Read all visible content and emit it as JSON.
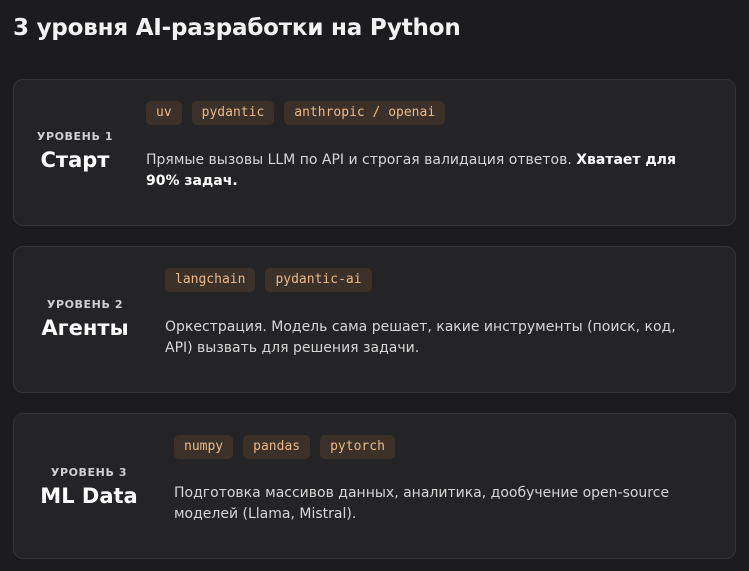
{
  "title": "3 уровня AI-разработки на Python",
  "levels": [
    {
      "label": "УРОВЕНЬ 1",
      "name": "Старт",
      "tags": [
        "uv",
        "pydantic",
        "anthropic / openai"
      ],
      "description": "Прямые вызовы LLM по API и строгая валидация ответов. ",
      "description_bold": "Хватает для 90% задач."
    },
    {
      "label": "УРОВЕНЬ 2",
      "name": "Агенты",
      "tags": [
        "langchain",
        "pydantic-ai"
      ],
      "description": "Оркестрация. Модель сама решает, какие инструменты (поиск, код, API) вызвать для решения задачи.",
      "description_bold": ""
    },
    {
      "label": "УРОВЕНЬ 3",
      "name": "ML Data",
      "tags": [
        "numpy",
        "pandas",
        "pytorch"
      ],
      "description": "Подготовка массивов данных, аналитика, дообучение open-source моделей (Llama, Mistral).",
      "description_bold": ""
    }
  ],
  "colors": {
    "background": "#1c1c1e",
    "card": "#242426",
    "tag_bg": "#3b3128",
    "tag_text": "#e8b98a"
  }
}
